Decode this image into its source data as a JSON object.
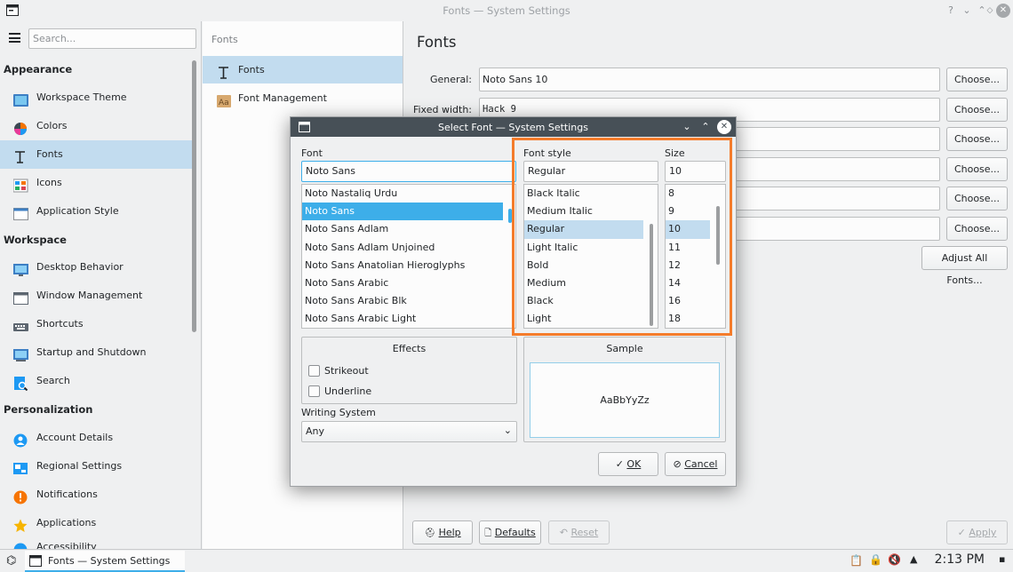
{
  "window": {
    "title": "Fonts — System Settings"
  },
  "sidebar": {
    "search_placeholder": "Search...",
    "sections": [
      {
        "title": "Appearance",
        "items": [
          "Workspace Theme",
          "Colors",
          "Fonts",
          "Icons",
          "Application Style"
        ]
      },
      {
        "title": "Workspace",
        "items": [
          "Desktop Behavior",
          "Window Management",
          "Shortcuts",
          "Startup and Shutdown",
          "Search"
        ]
      },
      {
        "title": "Personalization",
        "items": [
          "Account Details",
          "Regional Settings",
          "Notifications",
          "Applications",
          "Accessibility"
        ]
      }
    ],
    "selected": "Fonts"
  },
  "middle": {
    "title": "Fonts",
    "items": [
      "Fonts",
      "Font Management"
    ]
  },
  "right": {
    "title": "Fonts",
    "rows": [
      {
        "label": "General:",
        "value": "Noto Sans 10",
        "button": "Choose..."
      },
      {
        "label": "Fixed width:",
        "value": "Hack  9",
        "button": "Choose..."
      },
      {
        "label": "",
        "value": "",
        "button": "Choose..."
      },
      {
        "label": "",
        "value": "",
        "button": "Choose..."
      },
      {
        "label": "",
        "value": "",
        "button": "Choose..."
      },
      {
        "label": "",
        "value": "",
        "button": "Choose..."
      }
    ],
    "adjust_all": "Adjust All Fonts...",
    "help": "Help",
    "defaults": "Defaults",
    "reset": "Reset",
    "apply": "Apply"
  },
  "dialog": {
    "title": "Select Font — System Settings",
    "font_label": "Font",
    "font_value": "Noto Sans",
    "fonts": [
      "Noto Nastaliq Urdu",
      "Noto Sans",
      "Noto Sans Adlam",
      "Noto Sans Adlam Unjoined",
      "Noto Sans Anatolian Hieroglyphs",
      "Noto Sans Arabic",
      "Noto Sans Arabic Blk",
      "Noto Sans Arabic Light"
    ],
    "style_label": "Font style",
    "style_value": "Regular",
    "styles": [
      "Black Italic",
      "Medium Italic",
      "Regular",
      "Light Italic",
      "Bold",
      "Medium",
      "Black",
      "Light"
    ],
    "size_label": "Size",
    "size_value": "10",
    "sizes": [
      "8",
      "9",
      "10",
      "11",
      "12",
      "14",
      "16",
      "18"
    ],
    "effects_title": "Effects",
    "strikeout": "Strikeout",
    "underline": "Underline",
    "writing_system_label": "Writing System",
    "writing_system_value": "Any",
    "sample_title": "Sample",
    "sample_text": "AaBbYyZz",
    "ok": "OK",
    "cancel": "Cancel"
  },
  "taskbar": {
    "task_label": "Fonts  — System Settings",
    "clock": "2:13 PM"
  },
  "colors": {
    "accent": "#3daee9",
    "selection": "#c2dcef",
    "highlight_box": "#f47c2b",
    "dialog_titlebar": "#475057"
  }
}
